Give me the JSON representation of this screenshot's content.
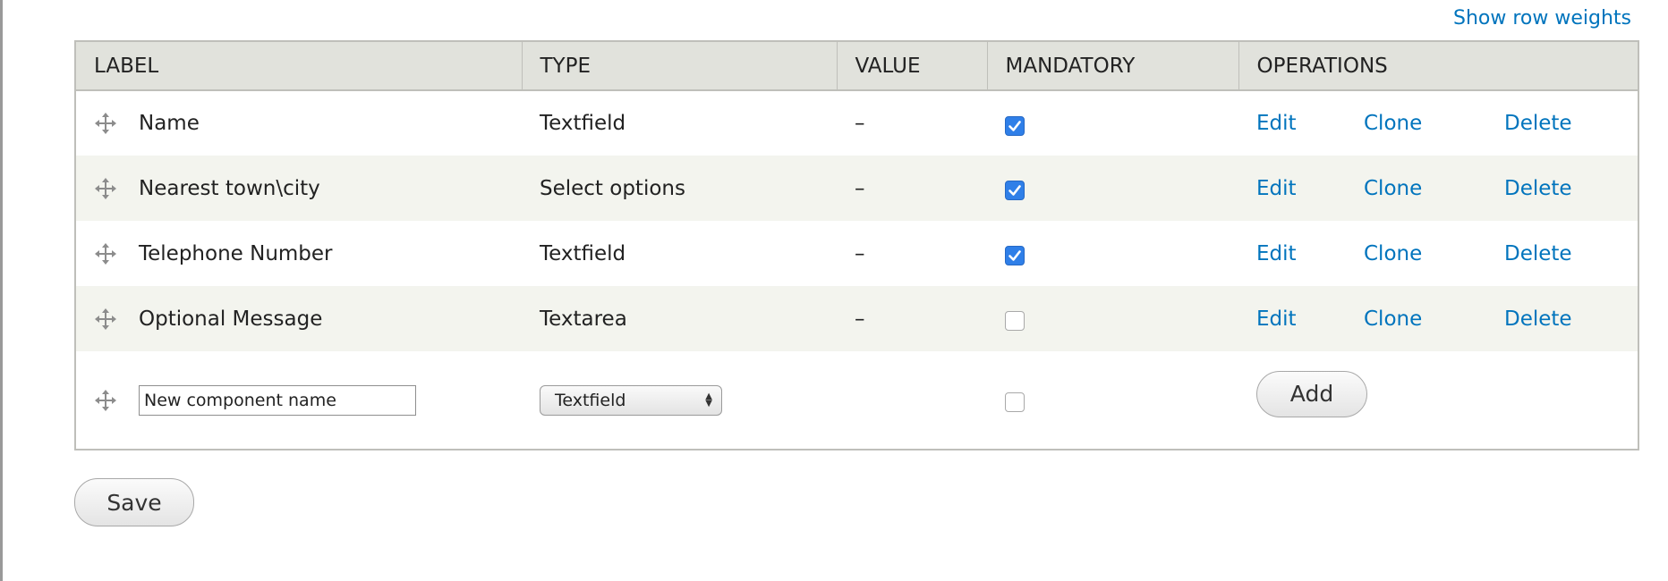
{
  "toggle_weights_label": "Show row weights",
  "columns": {
    "label": "LABEL",
    "type": "TYPE",
    "value": "VALUE",
    "mandatory": "MANDATORY",
    "operations": "OPERATIONS"
  },
  "rows": [
    {
      "label": "Name",
      "type": "Textfield",
      "value": "–",
      "mandatory": true,
      "edit": "Edit",
      "clone": "Clone",
      "delete": "Delete"
    },
    {
      "label": "Nearest town\\city",
      "type": "Select options",
      "value": "–",
      "mandatory": true,
      "edit": "Edit",
      "clone": "Clone",
      "delete": "Delete"
    },
    {
      "label": "Telephone Number",
      "type": "Textfield",
      "value": "–",
      "mandatory": true,
      "edit": "Edit",
      "clone": "Clone",
      "delete": "Delete"
    },
    {
      "label": "Optional Message",
      "type": "Textarea",
      "value": "–",
      "mandatory": false,
      "edit": "Edit",
      "clone": "Clone",
      "delete": "Delete"
    }
  ],
  "new_component": {
    "name_value": "New component name",
    "type_selected": "Textfield",
    "mandatory": false,
    "add_label": "Add"
  },
  "save_label": "Save",
  "colors": {
    "link": "#0074bd",
    "header_bg": "#e1e2dc",
    "alt_row_bg": "#f3f4ee",
    "checkbox_checked": "#2f7fe8"
  }
}
